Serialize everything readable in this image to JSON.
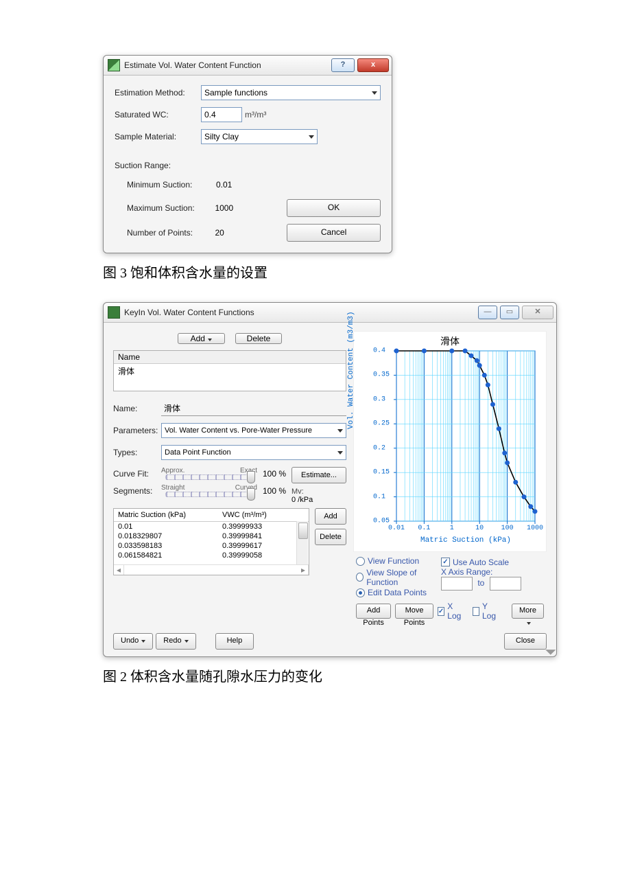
{
  "dialog1": {
    "title": "Estimate Vol. Water Content Function",
    "est_method_label": "Estimation Method:",
    "est_method_value": "Sample functions",
    "sat_wc_label": "Saturated WC:",
    "sat_wc_value": "0.4",
    "sat_wc_unit": "m³/m³",
    "sample_mat_label": "Sample Material:",
    "sample_mat_value": "Silty Clay",
    "range_label": "Suction Range:",
    "min_label": "Minimum Suction:",
    "min_value": "0.01",
    "max_label": "Maximum Suction:",
    "max_value": "1000",
    "npts_label": "Number of Points:",
    "npts_value": "20",
    "ok": "OK",
    "cancel": "Cancel"
  },
  "caption1": "图 3 饱和体积含水量的设置",
  "dialog2": {
    "title": "KeyIn Vol. Water Content Functions",
    "add": "Add",
    "delete": "Delete",
    "list_header": "Name",
    "list_item": "滑体",
    "name_label": "Name:",
    "name_value": "滑体",
    "params_label": "Parameters:",
    "params_value": "Vol. Water Content vs. Pore-Water Pressure",
    "types_label": "Types:",
    "types_value": "Data Point Function",
    "curvefit_label": "Curve Fit:",
    "approx": "Approx.",
    "exact": "Exact",
    "seg_label": "Segments:",
    "straight": "Straight",
    "curved": "Curved",
    "pct": "100 %",
    "estimate": "Estimate...",
    "mv_label": "Mv:",
    "mv_value": "0 /kPa",
    "col1": "Matric Suction (kPa)",
    "col2": "VWC (m³/m³)",
    "rows": [
      {
        "a": "0.01",
        "b": "0.39999933"
      },
      {
        "a": "0.018329807",
        "b": "0.39999841"
      },
      {
        "a": "0.033598183",
        "b": "0.39999617"
      },
      {
        "a": "0.061584821",
        "b": "0.39999058"
      }
    ],
    "add2": "Add",
    "delete2": "Delete",
    "view_fn": "View Function",
    "view_slope": "View Slope of Function",
    "edit_pts": "Edit Data Points",
    "auto_scale": "Use Auto Scale",
    "xrange": "X Axis Range:",
    "to": "to",
    "addpts": "Add Points",
    "movepts": "Move Points",
    "xlog": "X Log",
    "ylog": "Y Log",
    "more": "More",
    "undo": "Undo",
    "redo": "Redo",
    "help": "Help",
    "close": "Close"
  },
  "caption2": "图 2 体积含水量随孔隙水压力的变化",
  "chart_data": {
    "type": "line",
    "title": "滑体",
    "xlabel": "Matric Suction (kPa)",
    "ylabel": "Vol. Water Content (m3/m3)",
    "xlog": true,
    "xlim": [
      0.01,
      1000
    ],
    "ylim": [
      0.05,
      0.4
    ],
    "yticks": [
      0.05,
      0.1,
      0.15,
      0.2,
      0.25,
      0.3,
      0.35,
      0.4
    ],
    "xticks": [
      0.01,
      0.1,
      1,
      10,
      100,
      1000
    ],
    "x": [
      0.01,
      0.1,
      1,
      3,
      5,
      8,
      10,
      15,
      20,
      30,
      50,
      80,
      100,
      200,
      400,
      700,
      1000
    ],
    "y": [
      0.4,
      0.4,
      0.4,
      0.4,
      0.39,
      0.38,
      0.37,
      0.35,
      0.33,
      0.29,
      0.24,
      0.19,
      0.17,
      0.13,
      0.1,
      0.08,
      0.07
    ]
  }
}
